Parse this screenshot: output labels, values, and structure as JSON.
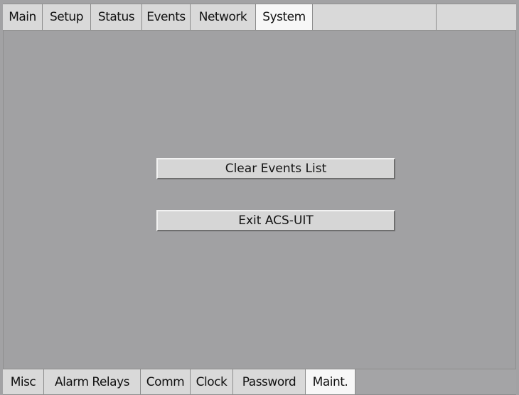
{
  "top_tabs": [
    "Main",
    "Setup",
    "Status",
    "Events",
    "Network",
    "System"
  ],
  "active_top_tab": "System",
  "buttons": {
    "clear_events": "Clear Events List",
    "exit": "Exit ACS-UIT"
  },
  "bottom_tabs": [
    "Misc",
    "Alarm Relays",
    "Comm",
    "Clock",
    "Password",
    "Maint."
  ],
  "active_bottom_tab": "Maint.",
  "colors": {
    "panel_gray": "#a1a1a3",
    "tab_gray": "#d9d9d9",
    "active_tab": "#f7f7f7",
    "button_face": "#d6d6d6"
  }
}
